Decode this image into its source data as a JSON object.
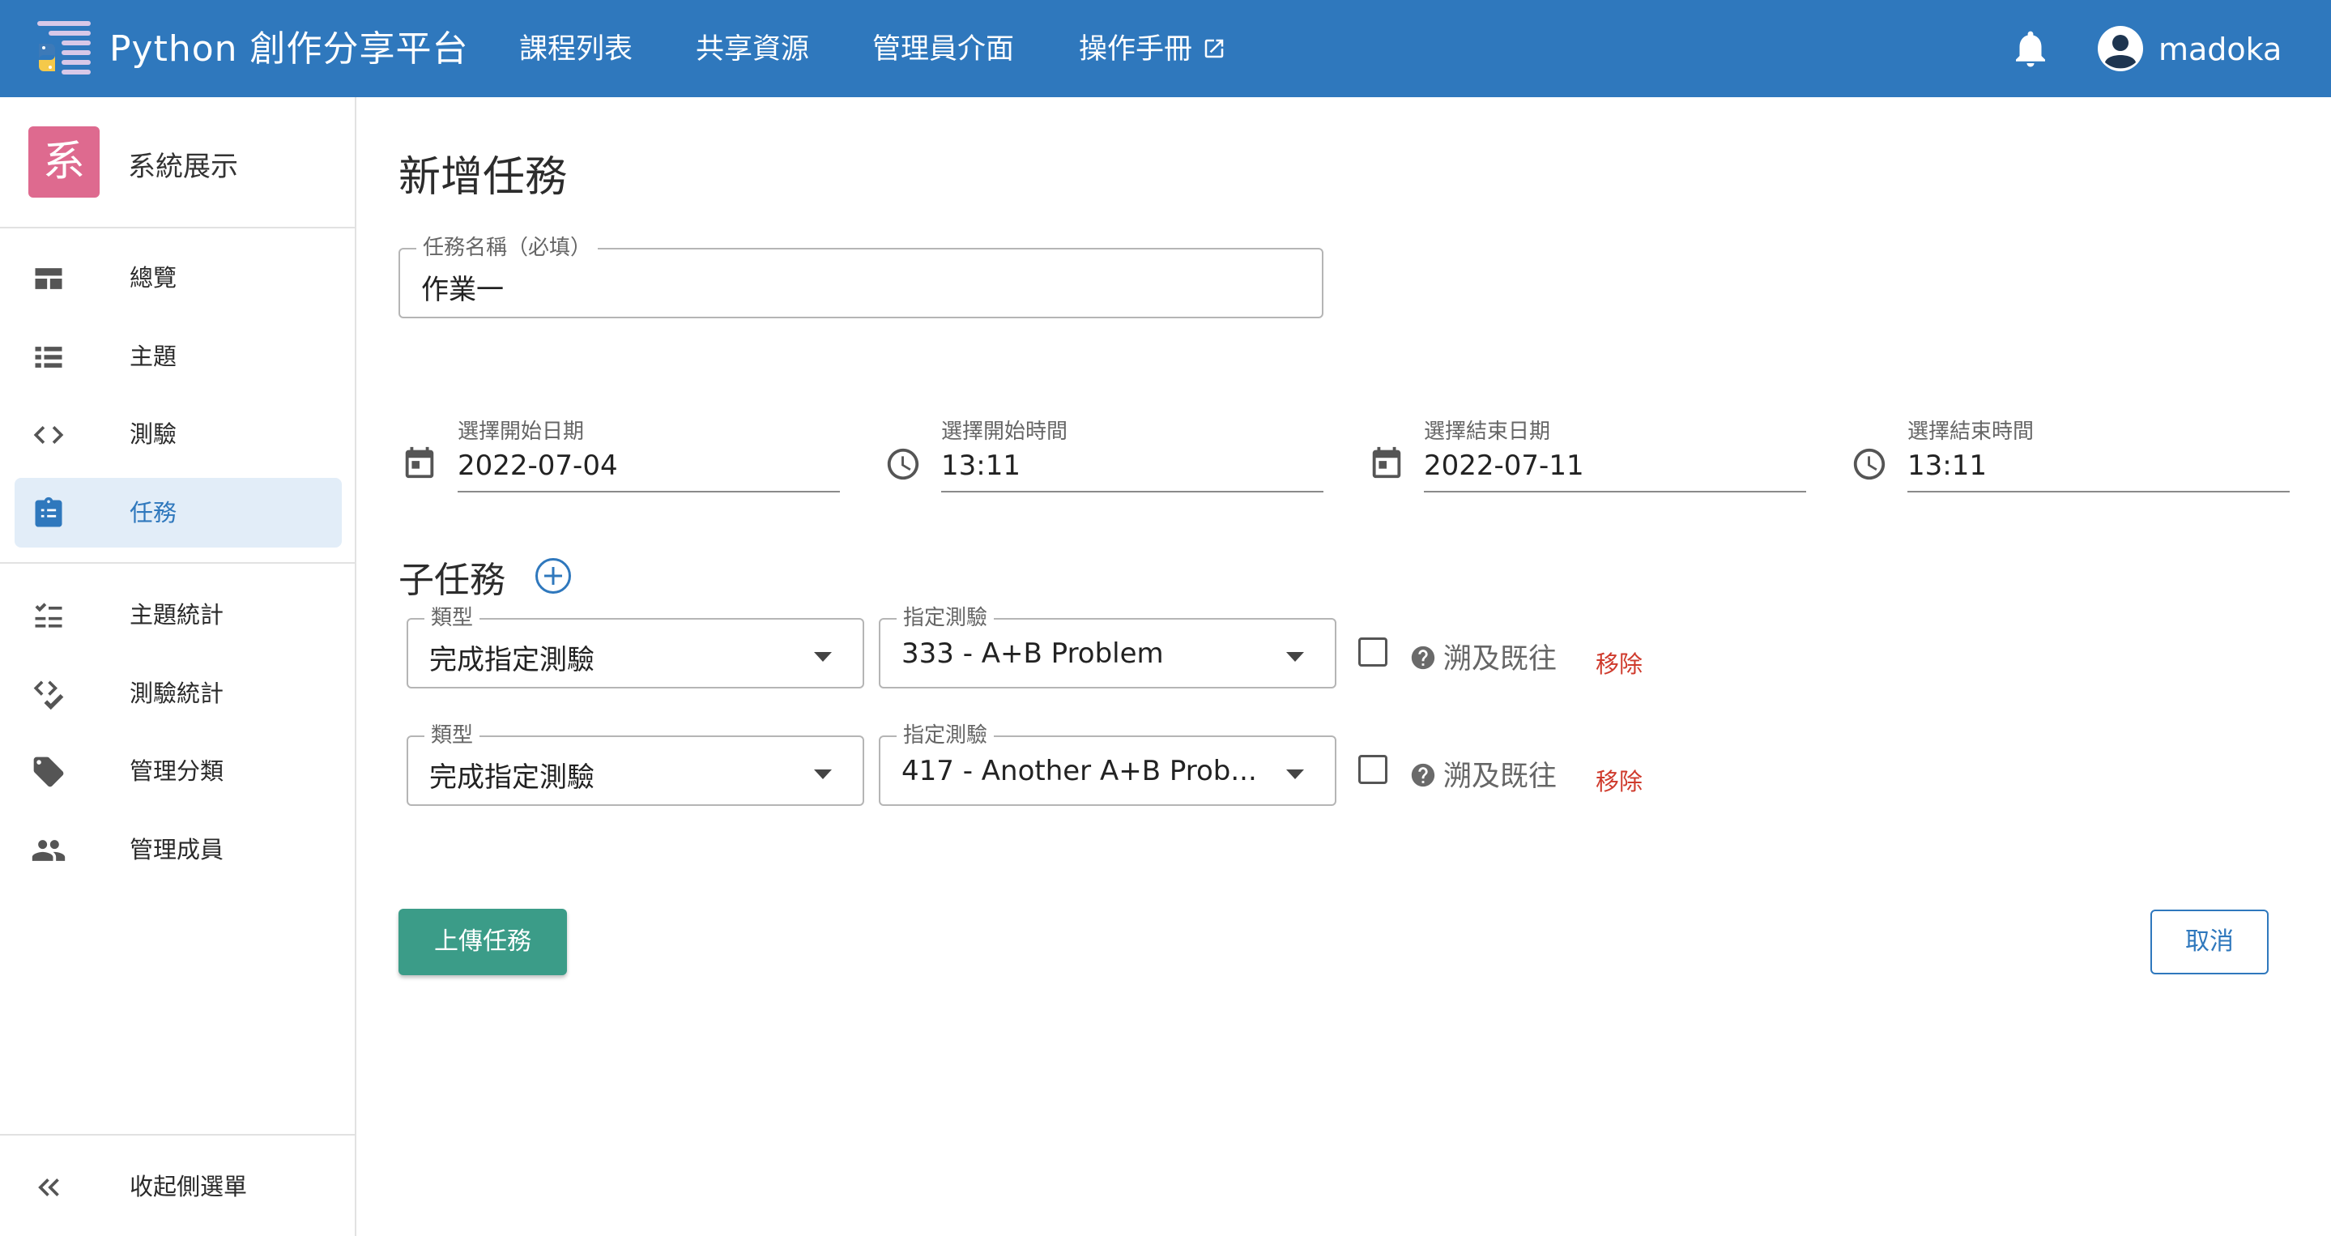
{
  "topbar": {
    "app_title": "Python 創作分享平台",
    "nav": [
      {
        "label": "課程列表"
      },
      {
        "label": "共享資源"
      },
      {
        "label": "管理員介面"
      },
      {
        "label": "操作手冊"
      }
    ],
    "username": "madoka",
    "colors": {
      "bar": "#2f78bd"
    }
  },
  "sidebar": {
    "course_badge": "系",
    "course_name": "系統展示",
    "items": [
      {
        "label": "總覽",
        "icon": "dashboard-icon"
      },
      {
        "label": "主題",
        "icon": "list-icon"
      },
      {
        "label": "測驗",
        "icon": "code-icon"
      },
      {
        "label": "任務",
        "icon": "assignment-icon",
        "active": true
      },
      {
        "label": "主題統計",
        "icon": "checklist-icon"
      },
      {
        "label": "測驗統計",
        "icon": "code-check-icon"
      },
      {
        "label": "管理分類",
        "icon": "tags-icon"
      },
      {
        "label": "管理成員",
        "icon": "people-icon"
      }
    ],
    "collapse_label": "收起側選單"
  },
  "form": {
    "title": "新增任務",
    "task_name": {
      "label": "任務名稱（必填）",
      "value": "作業一"
    },
    "start_date": {
      "label": "選擇開始日期",
      "value": "2022-07-04"
    },
    "start_time": {
      "label": "選擇開始時間",
      "value": "13:11"
    },
    "end_date": {
      "label": "選擇結束日期",
      "value": "2022-07-11"
    },
    "end_time": {
      "label": "選擇結束時間",
      "value": "13:11"
    },
    "subtasks_title": "子任務",
    "subtasks": [
      {
        "type_label": "類型",
        "type_value": "完成指定測驗",
        "quiz_label": "指定測驗",
        "quiz_value": "333 - A+B Problem",
        "retro_label": "溯及既往",
        "retro_checked": false,
        "remove_label": "移除"
      },
      {
        "type_label": "類型",
        "type_value": "完成指定測驗",
        "quiz_label": "指定測驗",
        "quiz_value": "417 - Another A+B Prob...",
        "retro_label": "溯及既往",
        "retro_checked": false,
        "remove_label": "移除"
      }
    ],
    "submit_label": "上傳任務",
    "cancel_label": "取消"
  }
}
